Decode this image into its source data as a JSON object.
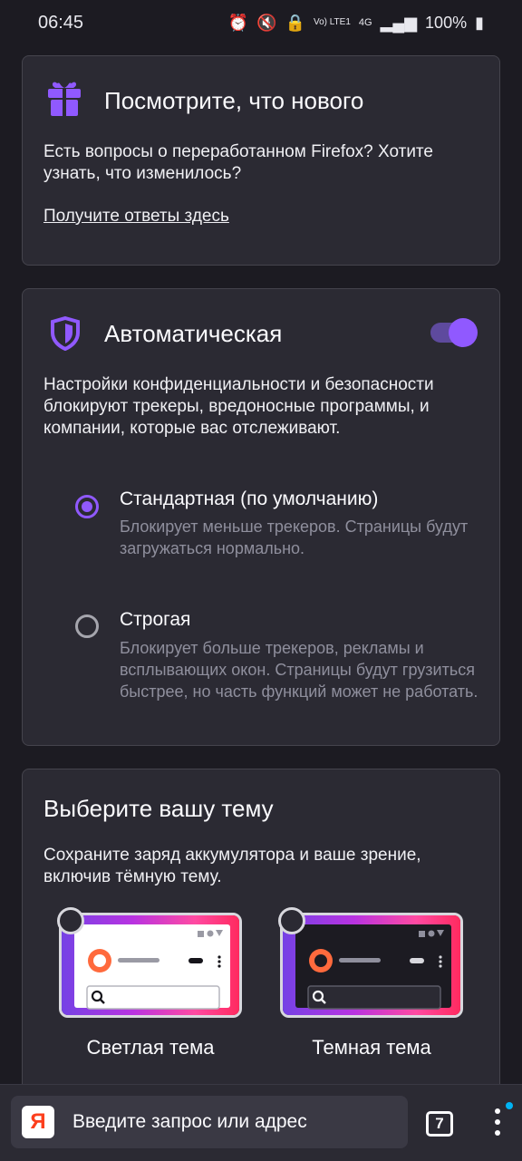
{
  "status": {
    "time": "06:45",
    "network": "Vo) LTE1",
    "net_type": "4G",
    "battery": "100%"
  },
  "whats_new": {
    "title": "Посмотрите, что нового",
    "text": "Есть вопросы о переработанном Firefox? Хотите узнать, что изменилось?",
    "link": "Получите ответы здесь",
    "icon": "gift-icon"
  },
  "tracking": {
    "title": "Автоматическая",
    "icon": "shield-icon",
    "toggle_on": true,
    "text": "Настройки конфиденциальности и безопасности блокируют трекеры, вредоносные программы, и компании, которые вас отслеживают.",
    "options": [
      {
        "title": "Стандартная (по умолчанию)",
        "desc": "Блокирует меньше трекеров. Страницы будут загружаться нормально.",
        "checked": true
      },
      {
        "title": "Строгая",
        "desc": "Блокирует больше трекеров, рекламы и всплывающих окон. Страницы будут грузиться быстрее, но часть функций может не работать.",
        "checked": false
      }
    ]
  },
  "theme": {
    "title": "Выберите вашу тему",
    "text": "Сохраните заряд аккумулятора и ваше зрение, включив тёмную тему.",
    "light_label": "Светлая тема",
    "dark_label": "Темная тема"
  },
  "toolbar": {
    "search_placeholder": "Введите запрос или адрес",
    "engine_letter": "Я",
    "tab_count": "7"
  },
  "colors": {
    "accent": "#9059ff",
    "background": "#1c1b22",
    "card": "#2b2a33"
  }
}
